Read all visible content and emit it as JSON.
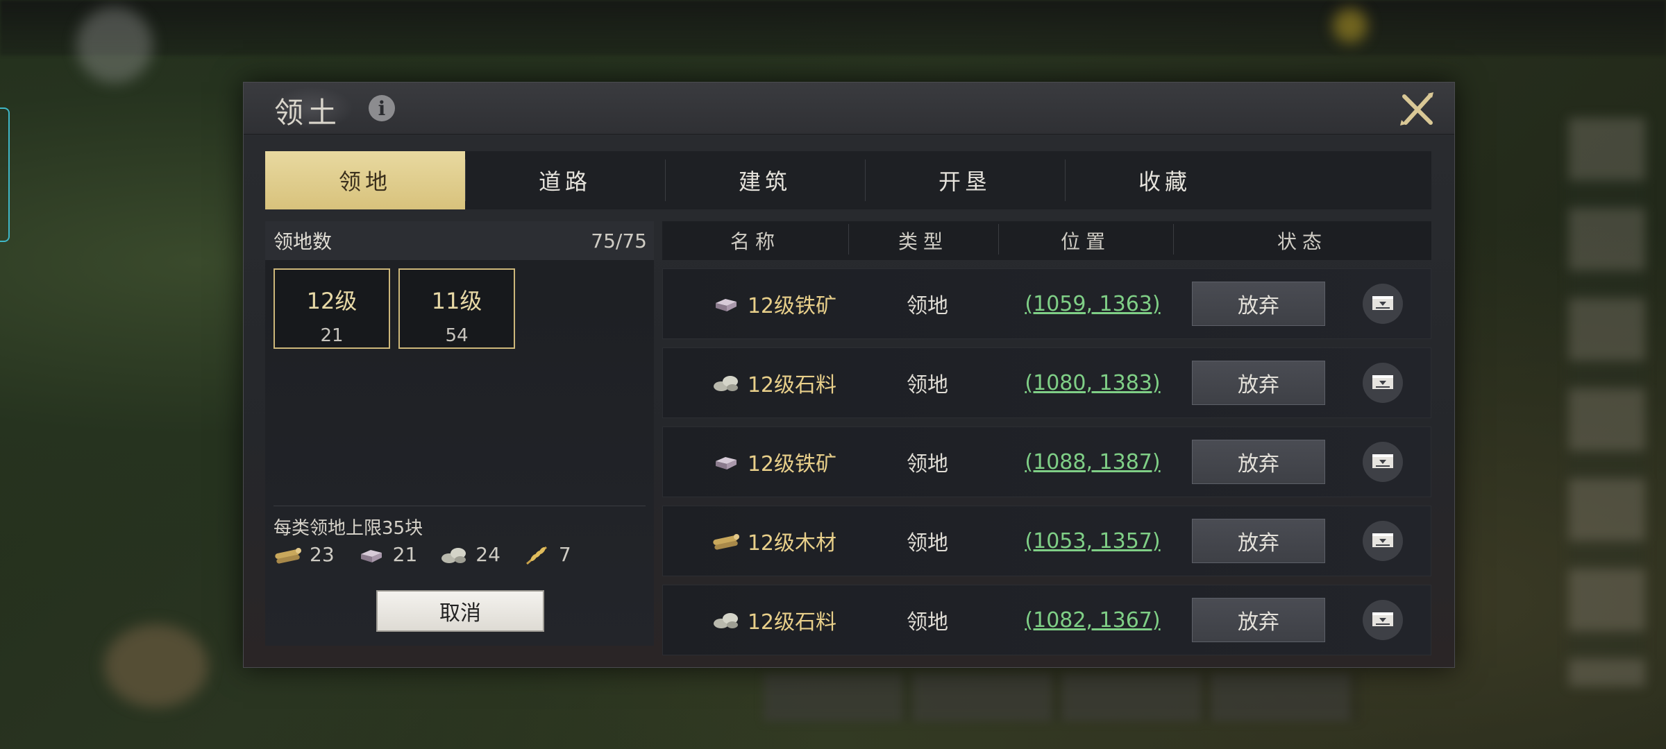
{
  "dialog": {
    "title": "领土",
    "tabs": [
      {
        "label": "领地",
        "active": true
      },
      {
        "label": "道路",
        "active": false
      },
      {
        "label": "建筑",
        "active": false
      },
      {
        "label": "开垦",
        "active": false
      },
      {
        "label": "收藏",
        "active": false
      }
    ]
  },
  "summary": {
    "label": "领地数",
    "count": "75/75",
    "levels": [
      {
        "level": "12级",
        "count": "21"
      },
      {
        "level": "11级",
        "count": "54"
      }
    ],
    "limit_text": "每类领地上限35块",
    "resources": [
      {
        "icon": "wood-icon",
        "value": "23"
      },
      {
        "icon": "iron-ore-icon",
        "value": "21"
      },
      {
        "icon": "stone-icon",
        "value": "24"
      },
      {
        "icon": "grain-icon",
        "value": "7"
      }
    ],
    "cancel_label": "取消"
  },
  "table": {
    "headers": [
      "名称",
      "类型",
      "位置",
      "状态"
    ],
    "abandon_label": "放弃",
    "rows": [
      {
        "icon": "iron-ore-icon",
        "name": "12级铁矿",
        "type": "领地",
        "position": "(1059, 1363)"
      },
      {
        "icon": "stone-icon",
        "name": "12级石料",
        "type": "领地",
        "position": "(1080, 1383)"
      },
      {
        "icon": "iron-ore-icon",
        "name": "12级铁矿",
        "type": "领地",
        "position": "(1088, 1387)"
      },
      {
        "icon": "wood-icon",
        "name": "12级木材",
        "type": "领地",
        "position": "(1053, 1357)"
      },
      {
        "icon": "stone-icon",
        "name": "12级石料",
        "type": "领地",
        "position": "(1082, 1367)"
      }
    ]
  },
  "colors": {
    "accent_gold": "#d8c27c",
    "coordinate_green": "#7fcf86",
    "name_gold": "#e8cf8a"
  }
}
